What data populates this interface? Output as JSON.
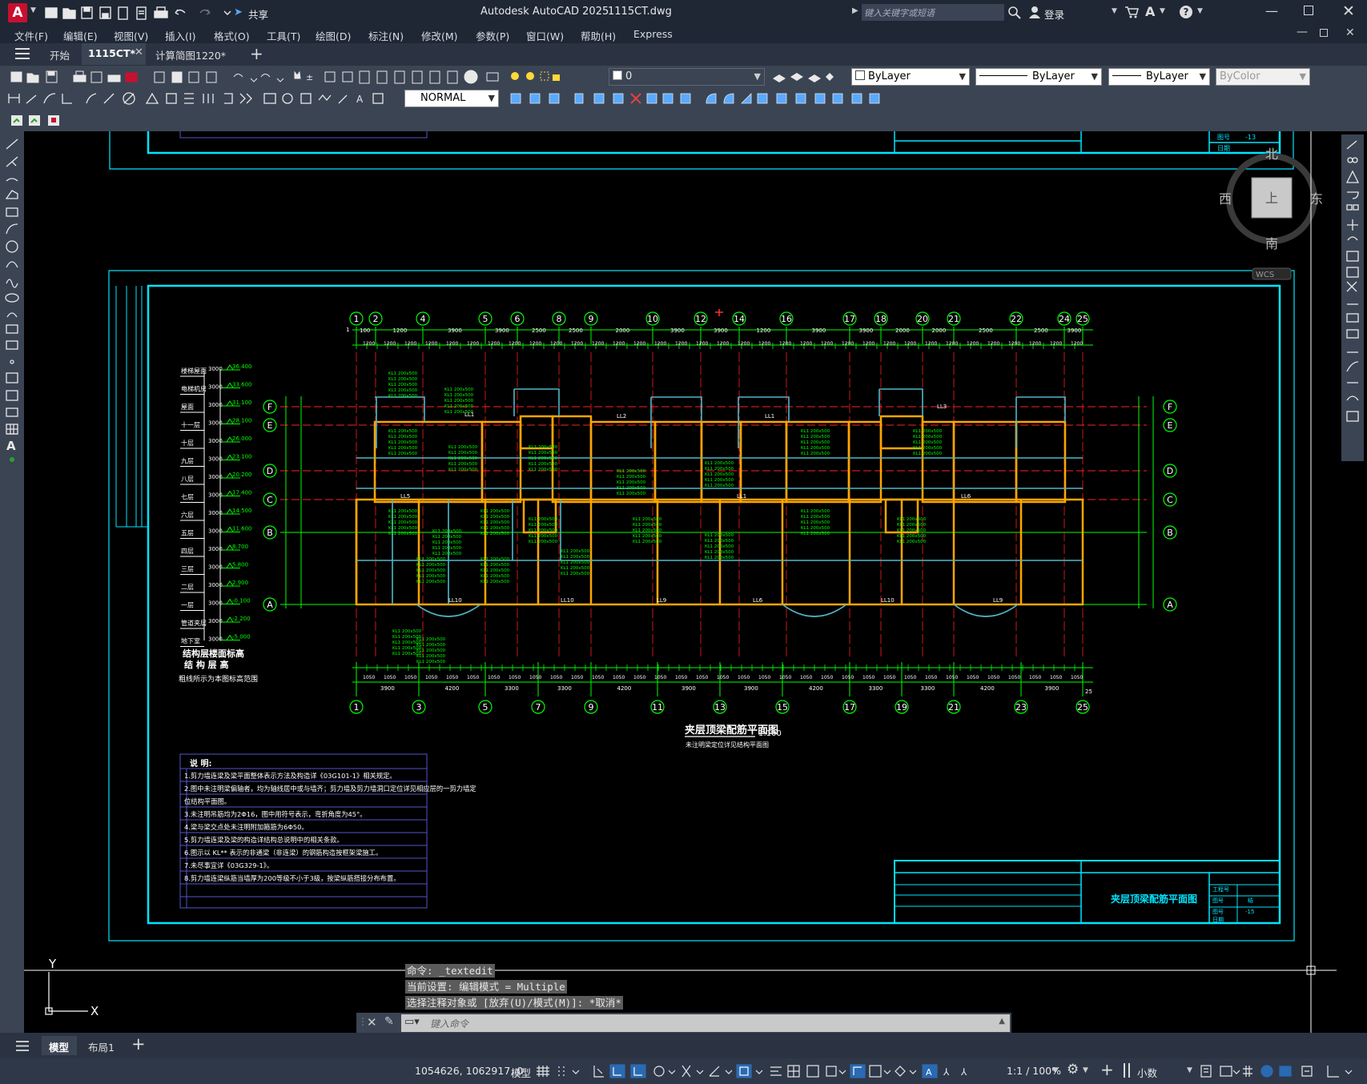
{
  "app": {
    "title": "Autodesk AutoCAD 2025",
    "file": "1115CT.dwg",
    "search_placeholder": "键入关键字或短语",
    "login": "登录",
    "share": "共享"
  },
  "menu": [
    "文件(F)",
    "编辑(E)",
    "视图(V)",
    "插入(I)",
    "格式(O)",
    "工具(T)",
    "绘图(D)",
    "标注(N)",
    "修改(M)",
    "参数(P)",
    "窗口(W)",
    "帮助(H)",
    "Express"
  ],
  "tabs": [
    {
      "label": "开始",
      "active": false
    },
    {
      "label": "1115CT*",
      "active": true
    },
    {
      "label": "计算简图1220*",
      "active": false
    }
  ],
  "toolbar": {
    "layer_value": "0",
    "color": "ByLayer",
    "linetype": "ByLayer",
    "lineweight": "ByLayer",
    "plotstyle": "ByColor",
    "dimstyle": "NORMAL"
  },
  "viewcube": {
    "north": "北",
    "south": "南",
    "east": "东",
    "west": "西",
    "face": "上",
    "wcs": "WCS"
  },
  "drawing": {
    "title": "夹层顶梁配筋平面图",
    "scale": "1:100",
    "subtitle": "未注明梁定位详见结构平面图",
    "title_block_name": "夹层顶梁配筋平面图",
    "title_block_rows": [
      "工程号",
      "图号",
      "图号",
      "日期"
    ],
    "title_block_vals": [
      "",
      "结",
      "-15",
      ""
    ],
    "top_title_block_vals": [
      "-13",
      ""
    ],
    "axes_top": [
      "1",
      "2",
      "4",
      "5",
      "6",
      "8",
      "9",
      "10",
      "12",
      "14",
      "16",
      "17",
      "18",
      "20",
      "21",
      "22",
      "24",
      "25"
    ],
    "axes_bottom": [
      "1",
      "3",
      "5",
      "7",
      "9",
      "11",
      "13",
      "15",
      "17",
      "19",
      "21",
      "23",
      "25"
    ],
    "axes_side": [
      "F",
      "E",
      "D",
      "C",
      "B",
      "A"
    ],
    "top_dims": [
      "100",
      "1200",
      "3900",
      "3900",
      "2500",
      "2500",
      "2000",
      "3900",
      "3900",
      "1200",
      "3900",
      "3900",
      "2000",
      "2000",
      "2500",
      "2500",
      "3900",
      "1200",
      "100"
    ],
    "bottom_dims": [
      "3900",
      "4200",
      "3300",
      "3300",
      "4200",
      "3900",
      "3900",
      "4200",
      "3300",
      "3300",
      "4200",
      "3900"
    ],
    "floor_levels": [
      {
        "name": "楼梯屋面",
        "elev": "36.400"
      },
      {
        "name": "电梯机房",
        "elev": "33.600"
      },
      {
        "name": "屋面",
        "elev": "31.100"
      },
      {
        "name": "十一层",
        "elev": "28.100"
      },
      {
        "name": "十层",
        "elev": "26.000"
      },
      {
        "name": "九层",
        "elev": "23.100"
      },
      {
        "name": "八层",
        "elev": "20.200"
      },
      {
        "name": "七层",
        "elev": "17.400"
      },
      {
        "name": "六层",
        "elev": "14.500"
      },
      {
        "name": "五层",
        "elev": "11.600"
      },
      {
        "name": "四层",
        "elev": "8.700"
      },
      {
        "name": "三层",
        "elev": "5.800"
      },
      {
        "name": "二层",
        "elev": "2.900"
      },
      {
        "name": "一层",
        "elev": "-0.100"
      },
      {
        "name": "管道夹层",
        "elev": "-2.200"
      },
      {
        "name": "地下室",
        "elev": "-5.000"
      }
    ],
    "level_table_caption1": "结构层楼面标高",
    "level_table_caption2": "结 构 层 高",
    "level_table_caption3": "粗线所示为本图标高范围",
    "notes_title": "说 明:",
    "notes": [
      "1.剪力墙连梁及梁平面整体表示方法及构造详《03G101-1》相关规定。",
      "2.图中未注明梁偏轴者，均为轴线居中或与墙齐；剪力墙及剪力墙洞口定位详见相应层的一剪力墙定",
      "  位结构平面图。",
      "3.未注明吊筋均为2Φ16，图中用符号表示，弯折角度为45°。",
      "4.梁与梁交点处未注明附加箍筋为6Φ50。",
      "5.剪力墙连梁及梁的构造详结构总说明中的相关条款。",
      "6.图示以 KL** 表示的非通梁（非连梁）的钢筋构造按框架梁施工。",
      "7.未尽事宜详《03G329-1》。",
      "8.剪力墙连梁纵筋当墙厚为200等级不小于3级，按梁纵筋搭接分布布置。"
    ],
    "gridnum_left": "1",
    "gridnum_right": "25"
  },
  "command": {
    "history": [
      "命令:  _textedit",
      "当前设置: 编辑模式 = Multiple",
      "选择注释对象或 [放弃(U)/模式(M)]: *取消*"
    ],
    "placeholder": "键入命令"
  },
  "layouts": [
    {
      "label": "模型",
      "active": true
    },
    {
      "label": "布局1",
      "active": false
    }
  ],
  "status": {
    "coords": "1054626, 1062917, 0",
    "model": "模型",
    "scale": "1:1 / 100%",
    "units": "小数"
  },
  "ucs": {
    "x": "X",
    "y": "Y"
  },
  "colors": {
    "accent": "#00e5ff",
    "axis": "#00ff00",
    "beam": "#ffa500",
    "dim": "#00ff00",
    "centerline": "#ff2020",
    "bg": "#000000"
  }
}
